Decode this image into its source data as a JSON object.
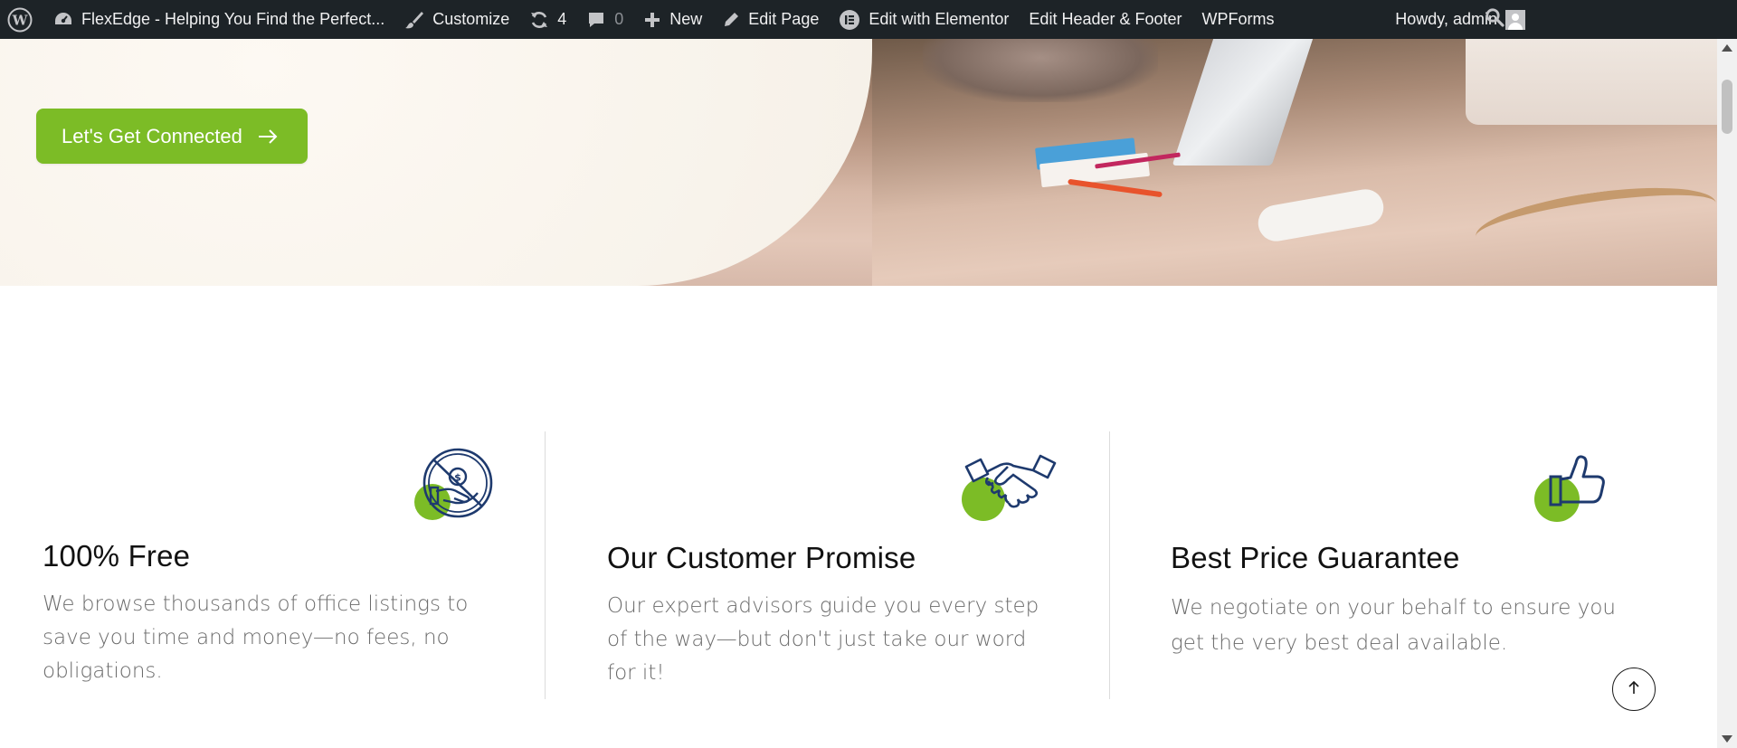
{
  "admin_bar": {
    "site_title": "FlexEdge - Helping You Find the Perfect...",
    "customize": "Customize",
    "updates_count": "4",
    "comments_count": "0",
    "new": "New",
    "edit_page": "Edit Page",
    "edit_elementor": "Edit with Elementor",
    "edit_header_footer": "Edit Header & Footer",
    "wpforms": "WPForms",
    "greeting": "Howdy, admin",
    "icons": [
      "wordpress-logo-icon",
      "dashboard-icon",
      "brush-icon",
      "refresh-icon",
      "comment-icon",
      "plus-icon",
      "pencil-icon",
      "elementor-icon",
      "user-avatar-icon",
      "search-icon"
    ]
  },
  "hero": {
    "cta_label": "Let's Get Connected",
    "cta_icon": "arrow-right-icon"
  },
  "features": [
    {
      "title": "100% Free",
      "text": "We browse thousands of office listings to save you time and money—no fees, no obligations.",
      "icon": "no-fee-money-hand-icon"
    },
    {
      "title": "Our Customer Promise",
      "text": "Our expert advisors guide you every step of the way—but don't just take our word for it!",
      "icon": "handshake-icon"
    },
    {
      "title": "Best Price Guarantee",
      "text": "We negotiate on your behalf to ensure you get the very best deal available.",
      "icon": "thumbs-up-icon"
    }
  ],
  "colors": {
    "admin_bar_bg": "#1d2327",
    "accent_green": "#7cbc26",
    "icon_navy": "#1e3a6e",
    "heading": "#111111",
    "body_text": "#6b6b6b"
  },
  "scroll_top_icon": "arrow-up-icon"
}
